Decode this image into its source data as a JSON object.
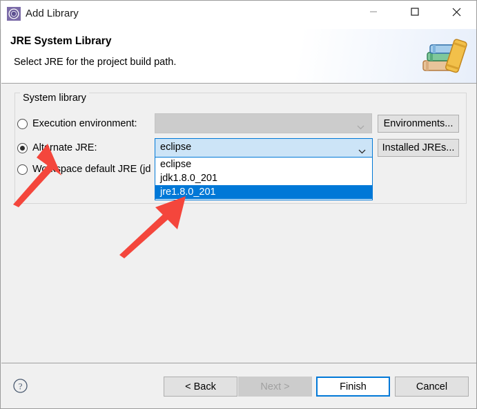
{
  "window": {
    "title": "Add Library",
    "icon": "eclipse-library-icon",
    "controls": {
      "minimize": "minimize-icon",
      "maximize": "maximize-icon",
      "close": "close-icon"
    }
  },
  "header": {
    "title": "JRE System Library",
    "description": "Select JRE for the project build path.",
    "banner_icon": "books-icon"
  },
  "system_library": {
    "group_label": "System library",
    "options": [
      {
        "id": "execution-environment",
        "label": "Execution environment:",
        "checked": false,
        "enabled": false
      },
      {
        "id": "alternate-jre",
        "label": "Alternate JRE:",
        "checked": true,
        "enabled": true
      },
      {
        "id": "workspace-default-jre",
        "label": "Workspace default JRE (jd",
        "checked": false,
        "enabled": true
      }
    ],
    "execution_environment_combo": {
      "value": "",
      "placeholder": "",
      "enabled": false
    },
    "alternate_jre_combo": {
      "value": "eclipse",
      "expanded": true,
      "options": [
        {
          "label": "eclipse",
          "selected": false
        },
        {
          "label": "jdk1.8.0_201",
          "selected": false
        },
        {
          "label": "jre1.8.0_201",
          "selected": true
        }
      ]
    },
    "buttons": {
      "environments": "Environments...",
      "installed_jres": "Installed JREs..."
    }
  },
  "footer": {
    "help": "help-icon",
    "back": "< Back",
    "next": "Next >",
    "finish": "Finish",
    "cancel": "Cancel"
  },
  "annotations": {
    "arrow_color": "#f4463c",
    "arrows": [
      {
        "name": "arrow-to-alternate-jre"
      },
      {
        "name": "arrow-to-jre-option"
      }
    ]
  },
  "colors": {
    "accent": "#0078d7",
    "selection": "#0078d7",
    "combo_field": "#cce4f7",
    "dialog_bg": "#f0f0f0",
    "disabled": "#cccccc"
  }
}
